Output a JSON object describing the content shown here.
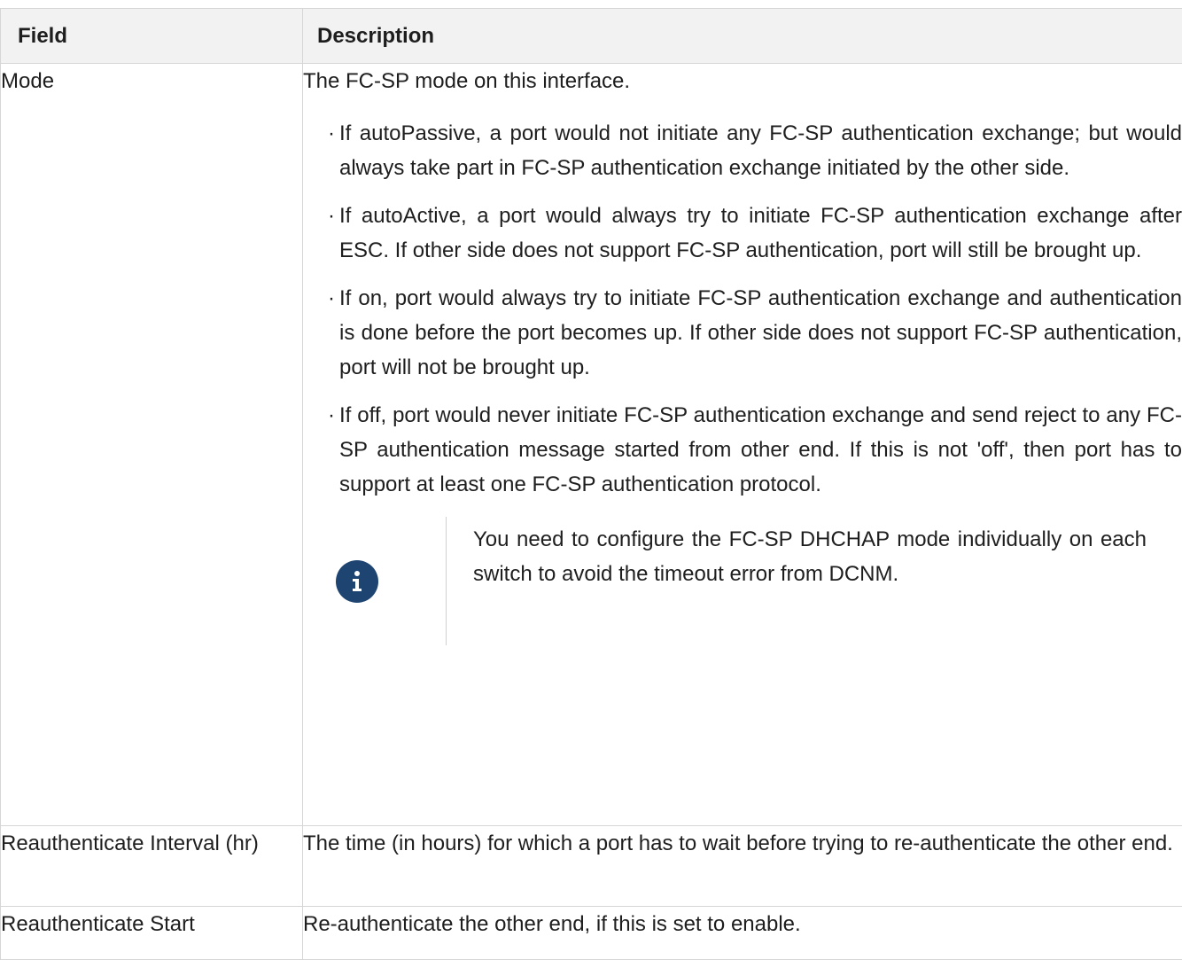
{
  "table": {
    "headers": [
      "Field",
      "Description"
    ],
    "rows": [
      {
        "field": "Mode",
        "description": "The FC-SP mode on this interface.",
        "bullets": [
          "If autoPassive, a port would not initiate any FC-SP authentication exchange; but would always take part in FC-SP authentication exchange initiated by the other side.",
          "If autoActive, a port would always try to initiate FC-SP authentication exchange after ESC. If other side does not support FC-SP authentication, port will still be brought up.",
          "If on, port would always try to initiate FC-SP authentication exchange and authentication is done before the port becomes up. If other side does not support FC-SP authentication, port will not be brought up.",
          "If off, port would never initiate FC-SP authentication exchange and send reject to any FC-SP authentication message started from other end. If this is not 'off', then port has to support at least one FC-SP authentication protocol."
        ],
        "note": {
          "icon": "info-icon",
          "text": "You need to configure the FC-SP DHCHAP mode individually on each switch to avoid the timeout error from DCNM."
        }
      },
      {
        "field": "Reauthenticate Interval (hr)",
        "description": "The time (in hours) for which a port has to wait before trying to re-authenticate the other end."
      },
      {
        "field": "Reauthenticate Start",
        "description": "Re-authenticate the other end, if this is set to enable."
      }
    ]
  },
  "colors": {
    "header_bg": "#f2f2f2",
    "border": "#d6d6d6",
    "info_icon_bg": "#1e4471",
    "text": "#1e1e1e"
  }
}
